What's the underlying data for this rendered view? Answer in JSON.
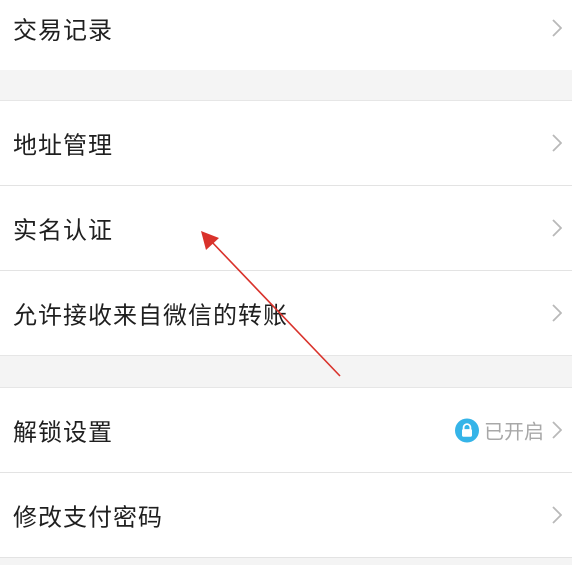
{
  "menu": {
    "transactions": "交易记录",
    "address": "地址管理",
    "realname": "实名认证",
    "wechat_transfer": "允许接收来自微信的转账",
    "unlock": "解锁设置",
    "unlock_status": "已开启",
    "change_password": "修改支付密码"
  },
  "icons": {
    "chevron": "chevron-right-icon",
    "lock": "lock-icon"
  },
  "colors": {
    "lock_badge": "#35b4e8",
    "annotation_arrow": "#d9322b",
    "status_text": "#a8a8a8"
  }
}
